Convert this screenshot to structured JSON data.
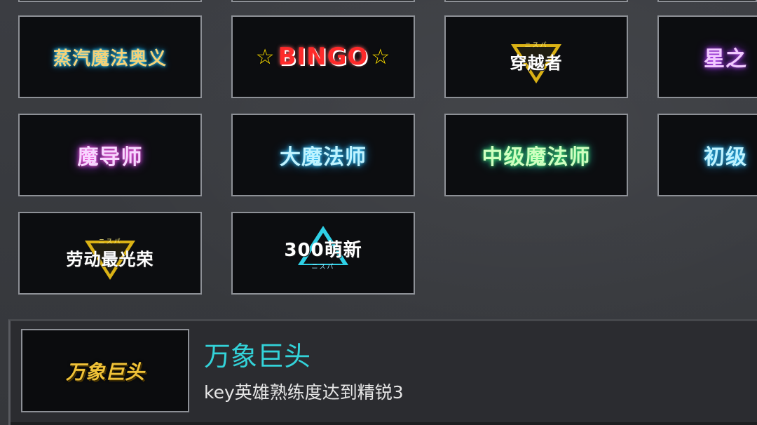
{
  "titles": [
    {
      "id": "steam-magic",
      "text": "蒸汽魔法奥义"
    },
    {
      "id": "bingo",
      "text": "BINGO"
    },
    {
      "id": "time-traveler",
      "text": "穿越者",
      "tag": "ニスパ"
    },
    {
      "id": "star-partial",
      "text": "星之"
    },
    {
      "id": "magic-guide",
      "text": "魔导师"
    },
    {
      "id": "grand-mage",
      "text": "大魔法师"
    },
    {
      "id": "mid-mage",
      "text": "中级魔法师"
    },
    {
      "id": "junior-partial",
      "text": "初级"
    },
    {
      "id": "labor-glory",
      "text": "劳动最光荣",
      "tag": "ニスパ"
    },
    {
      "id": "newbie-300",
      "text": "300萌新",
      "tag": "ニスパ"
    }
  ],
  "selected": {
    "badge_text": "万象巨头",
    "name": "万象巨头",
    "description": "key英雄熟练度达到精锐3"
  },
  "colors": {
    "accent": "#33d3d9",
    "border": "#8d9096",
    "tile_bg": "#0c0d10"
  }
}
